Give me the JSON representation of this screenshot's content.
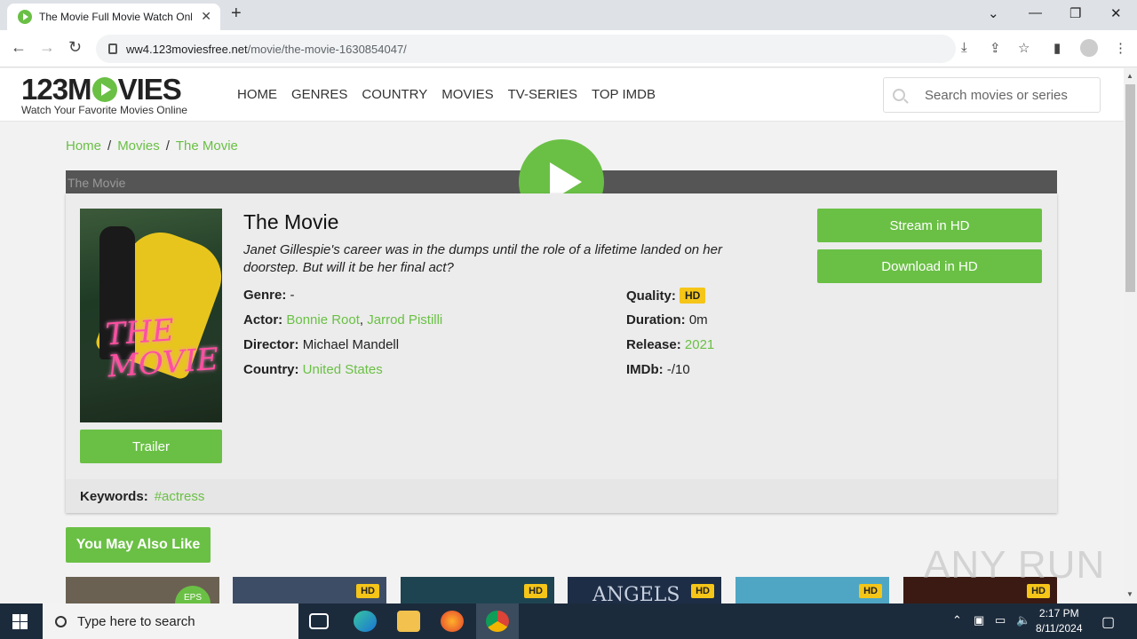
{
  "browser": {
    "tab_title": "The Movie Full Movie Watch Online",
    "url_host": "ww4.123moviesfree.net",
    "url_path": "/movie/the-movie-1630854047/"
  },
  "site": {
    "logo_text_a": "123M",
    "logo_text_b": "VIES",
    "tagline": "Watch Your Favorite Movies Online",
    "nav": [
      "HOME",
      "GENRES",
      "COUNTRY",
      "MOVIES",
      "TV-SERIES",
      "TOP IMDB"
    ],
    "search_placeholder": "Search movies or series"
  },
  "breadcrumb": [
    "Home",
    "Movies",
    "The Movie"
  ],
  "player": {
    "image_alt": "The Movie"
  },
  "movie": {
    "poster_text": "THE MOVIE",
    "title": "The Movie",
    "description": "Janet Gillespie's career was in the dumps until the role of a lifetime landed on her doorstep. But will it be her final act?",
    "genre_label": "Genre:",
    "genre": "-",
    "actor_label": "Actor:",
    "actors": [
      "Bonnie Root",
      "Jarrod Pistilli"
    ],
    "director_label": "Director:",
    "director": "Michael Mandell",
    "country_label": "Country:",
    "country": "United States",
    "quality_label": "Quality:",
    "quality": "HD",
    "duration_label": "Duration:",
    "duration": "0m",
    "release_label": "Release:",
    "release": "2021",
    "imdb_label": "IMDb:",
    "imdb": "-/10",
    "trailer_label": "Trailer",
    "stream_label": "Stream in HD",
    "download_label": "Download in HD",
    "keywords_label": "Keywords:",
    "keyword": "#actress"
  },
  "also_like": {
    "heading": "You May Also Like",
    "cards": [
      {
        "badge": "EPS",
        "color": "#6b6152"
      },
      {
        "badge": "HD",
        "color": "#3d4d66"
      },
      {
        "badge": "HD",
        "color": "#1e4452"
      },
      {
        "badge": "HD",
        "color": "#1d2d45",
        "text": "ANGELS"
      },
      {
        "badge": "HD",
        "color": "#4fa6c4"
      },
      {
        "badge": "HD",
        "color": "#3a1a12"
      }
    ]
  },
  "watermark": "ANY RUN",
  "taskbar": {
    "search_placeholder": "Type here to search",
    "time": "2:17 PM",
    "date": "8/11/2024"
  }
}
